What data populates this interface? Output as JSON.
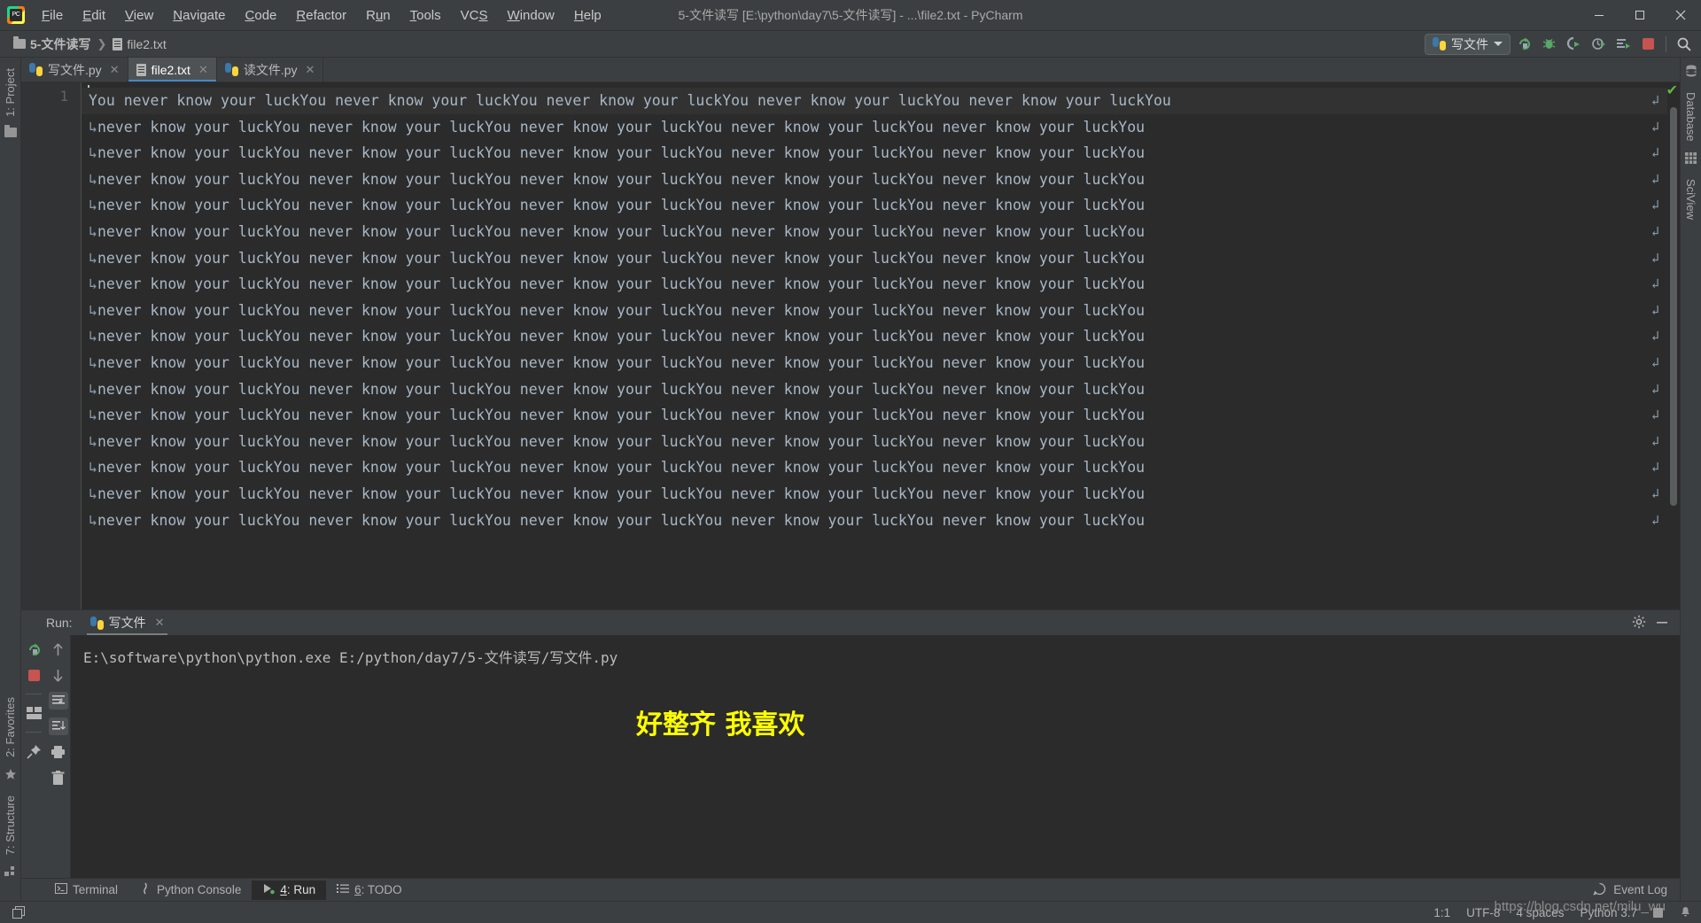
{
  "window": {
    "title": "5-文件读写 [E:\\python\\day7\\5-文件读写] - ...\\file2.txt - PyCharm",
    "logo_icon": "pycharm-logo-icon",
    "minimize_label": "—",
    "maximize_label": "❐",
    "close_label": "✕"
  },
  "menu": {
    "items": [
      {
        "pre": "",
        "key": "F",
        "post": "ile"
      },
      {
        "pre": "",
        "key": "E",
        "post": "dit"
      },
      {
        "pre": "",
        "key": "V",
        "post": "iew"
      },
      {
        "pre": "",
        "key": "N",
        "post": "avigate"
      },
      {
        "pre": "",
        "key": "C",
        "post": "ode"
      },
      {
        "pre": "",
        "key": "R",
        "post": "efactor"
      },
      {
        "pre": "R",
        "key": "u",
        "post": "n"
      },
      {
        "pre": "",
        "key": "T",
        "post": "ools"
      },
      {
        "pre": "VC",
        "key": "S",
        "post": ""
      },
      {
        "pre": "",
        "key": "W",
        "post": "indow"
      },
      {
        "pre": "",
        "key": "H",
        "post": "elp"
      }
    ]
  },
  "breadcrumb": {
    "project_folder": "5-文件读写",
    "separator": "❯",
    "file": "file2.txt",
    "folder_icon": "folder-icon",
    "file_icon": "text-file-icon"
  },
  "toolbar": {
    "run_config_name": "写文件",
    "run_config_icon": "python-file-icon",
    "dropdown_icon": "chevron-down-icon",
    "buttons": [
      {
        "name": "rerun-button",
        "icon": "rerun-icon"
      },
      {
        "name": "debug-button",
        "icon": "bug-icon"
      },
      {
        "name": "coverage-button",
        "icon": "coverage-run-icon"
      },
      {
        "name": "profile-button",
        "icon": "profile-run-icon"
      },
      {
        "name": "concurrency-button",
        "icon": "concurrency-diagram-icon"
      },
      {
        "name": "stop-button",
        "icon": "stop-square-icon"
      },
      {
        "name": "search-everywhere-button",
        "icon": "search-icon"
      }
    ]
  },
  "left_strip": {
    "top": [
      {
        "label": "1: Project",
        "icon": "project-folder-icon"
      }
    ],
    "bottom": [
      {
        "label": "2: Favorites",
        "icon": "star-icon"
      },
      {
        "label": "7: Structure",
        "icon": "structure-icon"
      }
    ]
  },
  "right_strip": {
    "items": [
      {
        "label": "Database",
        "icon": "database-icon"
      },
      {
        "label": "SciView",
        "icon": "sciview-grid-icon"
      }
    ]
  },
  "editor": {
    "tabs": [
      {
        "label": "写文件.py",
        "icon": "python-file-icon",
        "active": false,
        "close": "✕"
      },
      {
        "label": "file2.txt",
        "icon": "text-file-icon",
        "active": true,
        "close": "✕"
      },
      {
        "label": "读文件.py",
        "icon": "python-file-icon",
        "active": false,
        "close": "✕"
      }
    ],
    "line_numbers": [
      "1"
    ],
    "first_line": "You never know your luckYou never know your luckYou never know your luckYou never know your luckYou never know your luckYou",
    "wrapped_line": "never know your luckYou never know your luckYou never know your luckYou never know your luckYou never know your luckYou",
    "wrap_indicator": "↳",
    "wrap_arrow": "↲",
    "wrapped_line_count": 16,
    "inspection_ok_icon": "check-mark-icon",
    "inspection_ok_color": "#62b543"
  },
  "run_panel": {
    "label": "Run:",
    "tab_label": "写文件",
    "tab_icon": "python-run-icon",
    "tab_close": "✕",
    "settings_icon": "gear-icon",
    "hide_icon": "minimize-icon",
    "left_tools": [
      {
        "name": "rerun-button",
        "icon": "rerun-icon"
      },
      {
        "name": "stop-button",
        "icon": "stop-square-icon"
      },
      {
        "name": "layout-button",
        "icon": "layout-icon"
      },
      {
        "name": "pin-tab-button",
        "icon": "pin-icon"
      }
    ],
    "right_tools": [
      {
        "name": "scroll-up-button",
        "icon": "arrow-up-icon"
      },
      {
        "name": "scroll-down-button",
        "icon": "arrow-down-icon"
      },
      {
        "name": "soft-wrap-button",
        "icon": "soft-wrap-icon"
      },
      {
        "name": "scroll-to-end-button",
        "icon": "scroll-to-end-icon"
      },
      {
        "name": "print-button",
        "icon": "printer-icon"
      },
      {
        "name": "clear-all-button",
        "icon": "trash-icon"
      }
    ],
    "console_command": "E:\\software\\python\\python.exe E:/python/day7/5-文件读写/写文件.py",
    "annotation_text": "好整齐 我喜欢",
    "annotation_color": "#ffff00"
  },
  "bottom_bar": {
    "items": [
      {
        "pre": "Terminal",
        "key": "",
        "post": "",
        "icon": "terminal-icon",
        "active": false
      },
      {
        "pre": "Python Console",
        "key": "",
        "post": "",
        "icon": "python-console-icon",
        "active": false
      },
      {
        "pre": "",
        "key": "4",
        "post": ": Run",
        "icon": "run-triangle-icon",
        "active": true
      },
      {
        "pre": "",
        "key": "6",
        "post": ": TODO",
        "icon": "todo-list-icon",
        "active": false
      }
    ],
    "event_log": "Event Log",
    "event_log_icon": "event-log-icon"
  },
  "status_bar": {
    "toggle_icon": "toggle-sidebar-icon",
    "caret_position": "1:1",
    "encoding": "UTF-8",
    "indent": "4 spaces",
    "interpreter": "Python 3.7",
    "lock_icon": "readonly-lock-icon",
    "notification_icon": "notification-icon"
  },
  "watermark": {
    "text": "https://blog.csdn.net/milu_wu"
  }
}
